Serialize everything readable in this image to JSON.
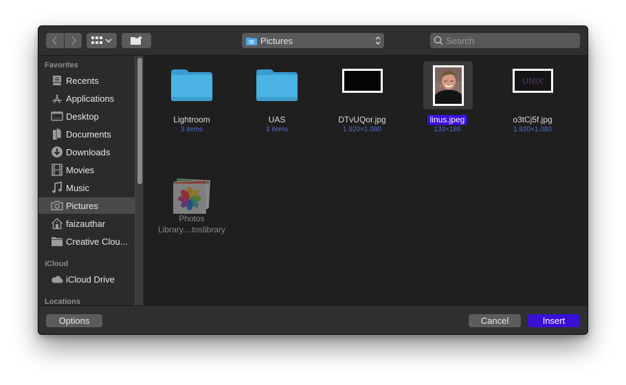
{
  "toolbar": {
    "back_icon": "chevron-left-icon",
    "forward_icon": "chevron-right-icon",
    "view_icon": "grid-view-icon",
    "new_folder_icon": "new-folder-icon",
    "location": "Pictures",
    "search_placeholder": "Search",
    "search_value": ""
  },
  "sidebar": {
    "sections": [
      {
        "title": "Favorites",
        "items": [
          {
            "label": "Recents",
            "icon": "recents-icon"
          },
          {
            "label": "Applications",
            "icon": "applications-icon"
          },
          {
            "label": "Desktop",
            "icon": "desktop-icon"
          },
          {
            "label": "Documents",
            "icon": "documents-icon"
          },
          {
            "label": "Downloads",
            "icon": "downloads-icon"
          },
          {
            "label": "Movies",
            "icon": "movies-icon"
          },
          {
            "label": "Music",
            "icon": "music-icon"
          },
          {
            "label": "Pictures",
            "icon": "camera-icon",
            "selected": true
          },
          {
            "label": "faizauthar",
            "icon": "home-icon"
          },
          {
            "label": "Creative Clou...",
            "icon": "folder-icon"
          }
        ]
      },
      {
        "title": "iCloud",
        "items": [
          {
            "label": "iCloud Drive",
            "icon": "cloud-icon"
          }
        ]
      },
      {
        "title": "Locations",
        "items": []
      }
    ]
  },
  "files": [
    {
      "name": "Lightroom",
      "meta": "3 items",
      "type": "folder"
    },
    {
      "name": "UAS",
      "meta": "3 items",
      "type": "folder"
    },
    {
      "name": "DTvUQor.jpg",
      "meta": "1.920×1.080",
      "type": "image"
    },
    {
      "name": "linus.jpeg",
      "meta": "133×186",
      "type": "image",
      "selected": true
    },
    {
      "name": "o3tCj5f.jpg",
      "meta": "1.920×1.080",
      "type": "image",
      "overlay_text": "UNIX"
    },
    {
      "name_line1": "Photos",
      "name_line2": "Library....toslibrary",
      "type": "photos-library",
      "disabled": true
    }
  ],
  "footer": {
    "options_label": "Options",
    "cancel_label": "Cancel",
    "insert_label": "Insert"
  },
  "colors": {
    "accent": "#3a0fd6",
    "folder_blue": "#4ab3e3",
    "meta_text": "#4b6fd0"
  }
}
